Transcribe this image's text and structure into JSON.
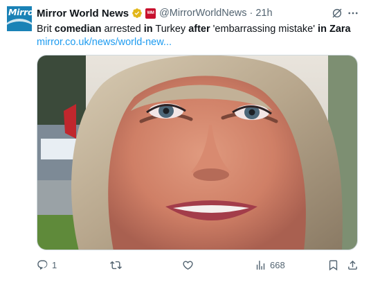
{
  "account": {
    "avatar_text": "Mirror",
    "display_name": "Mirror World News",
    "org_badge_text": "WM",
    "handle": "@MirrorWorldNews",
    "separator": "·",
    "time": "21h"
  },
  "tweet": {
    "segments": [
      {
        "text": "Brit ",
        "bold": false
      },
      {
        "text": "comedian",
        "bold": true
      },
      {
        "text": " arrested ",
        "bold": false
      },
      {
        "text": "in",
        "bold": true
      },
      {
        "text": " Turkey ",
        "bold": false
      },
      {
        "text": "after",
        "bold": true
      },
      {
        "text": " 'embarrassing mistake' ",
        "bold": false
      },
      {
        "text": "in Zara",
        "bold": true
      }
    ],
    "link": "mirror.co.uk/news/world-new..."
  },
  "actions": {
    "reply_count": "1",
    "views_count": "668"
  },
  "colors": {
    "accent": "#1d9bf0",
    "secondary_text": "#536471",
    "verified_gold": "#e2b719",
    "avatar_blue": "#1a82b6"
  },
  "icons": {
    "verified": "verified-badge-icon",
    "grok": "grok-icon",
    "more": "more-icon",
    "reply": "reply-icon",
    "retweet": "retweet-icon",
    "like": "heart-icon",
    "views": "views-chart-icon",
    "bookmark": "bookmark-icon",
    "share": "share-icon"
  }
}
